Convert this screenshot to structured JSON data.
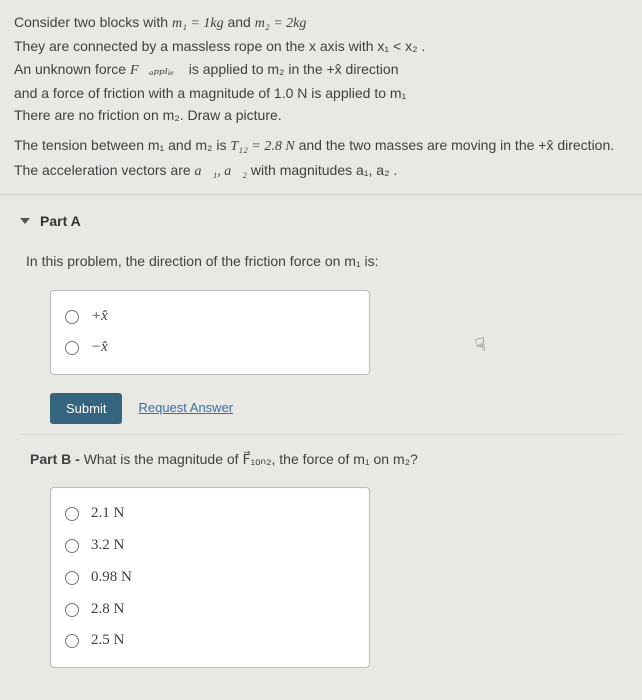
{
  "problem": {
    "line1_a": "Consider two blocks with ",
    "line1_b": " and ",
    "m1eq": "m₁ = 1kg",
    "m2eq": "m₂ = 2kg",
    "line2": "They are connected by a massless rope on the x axis with x₁ < x₂ .",
    "line3_a": "An unknown force ",
    "fapplied": "F⃗ₐₚₚₗᵢₑ𝒹",
    "line3_b": " is applied to m₂ in the +x̂ direction",
    "line4": "and a force of friction with a magnitude of 1.0 N is applied to m₁",
    "line5": "There are no friction on m₂. Draw a picture.",
    "line6_a": "The tension between m₁ and m₂ is ",
    "t12": "T₁₂ = 2.8 N",
    "line6_b": " and the two masses are moving in the +x̂ direction.",
    "line7_a": "The acceleration vectors are ",
    "a1a2": "a⃗₁, a⃗₂",
    "line7_b": " with magnitudes a₁, a₂ ."
  },
  "partA": {
    "title": "Part A",
    "question": "In this problem, the direction of the friction force on m₁ is:",
    "choices": [
      "+x̂",
      "−x̂"
    ],
    "submit": "Submit",
    "request": "Request Answer"
  },
  "partB": {
    "title_a": "Part B - ",
    "title_b": "What is the magnitude of F⃗₁ₒₙ₂, the force of m₁ on m₂?",
    "choices": [
      "2.1 N",
      "3.2 N",
      "0.98 N",
      "2.8 N",
      "2.5 N"
    ]
  }
}
